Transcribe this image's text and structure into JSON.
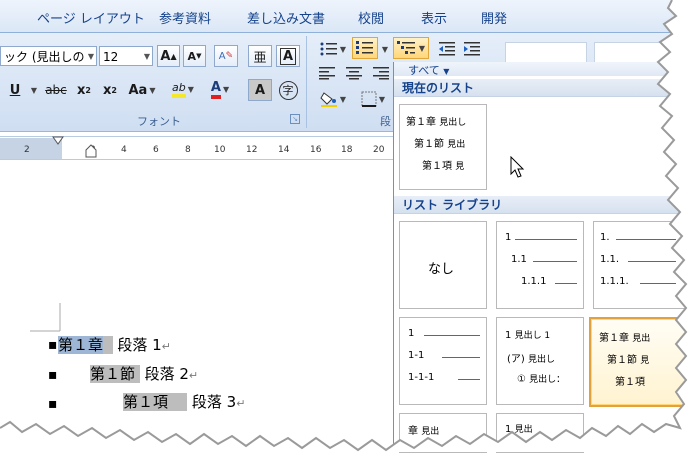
{
  "tabs": [
    "ページ レイアウト",
    "参考資料",
    "差し込み文書",
    "校閲",
    "表示",
    "開発"
  ],
  "font": {
    "name": "ック (見出しの",
    "size": "12",
    "grow_label": "A",
    "shrink_label": "A",
    "clear_label": "A",
    "phonetic_label": "亜",
    "border_char_label": "A",
    "underline_label": "U",
    "strike_label": "abc",
    "sub_label": "x",
    "sup_label": "x",
    "case_label": "Aa",
    "highlight_label": "ab",
    "color_label": "A",
    "shade_char_label": "A",
    "enclose_label": "字",
    "group_label": "フォント"
  },
  "paragraph": {
    "group_label": "段"
  },
  "gallery": {
    "filter_label": "すべて",
    "current_heading": "現在のリスト",
    "current_list": [
      "第１章",
      "見出し",
      "第１節",
      "見出",
      "第１項",
      "見"
    ],
    "library_heading": "リスト ライブラリ",
    "none_label": "なし",
    "lib_items": {
      "a": [
        "1",
        "1.1",
        "1.1.1"
      ],
      "b": [
        "1.",
        "1.1.",
        "1.1.1."
      ],
      "c": [
        "1",
        "1-1",
        "1-1-1"
      ],
      "d": [
        "1",
        "見出し 1",
        "(ア)",
        "見出し",
        "①",
        "見出し："
      ],
      "e": [
        "第１章",
        "見出",
        "第１節",
        "見",
        "第１項"
      ],
      "f": [
        "章",
        "見出",
        "1",
        "見出"
      ]
    }
  },
  "ruler": [
    "2",
    "2",
    "4",
    "6",
    "8",
    "10",
    "12",
    "14",
    "16",
    "18",
    "20"
  ],
  "document": {
    "p1": {
      "num": "第１章",
      "text": "段落 1"
    },
    "p2": {
      "num": "第１節",
      "text": "段落 2"
    },
    "p3": {
      "num": "第１項",
      "text": "段落 3"
    },
    "return_mark": "↵"
  }
}
